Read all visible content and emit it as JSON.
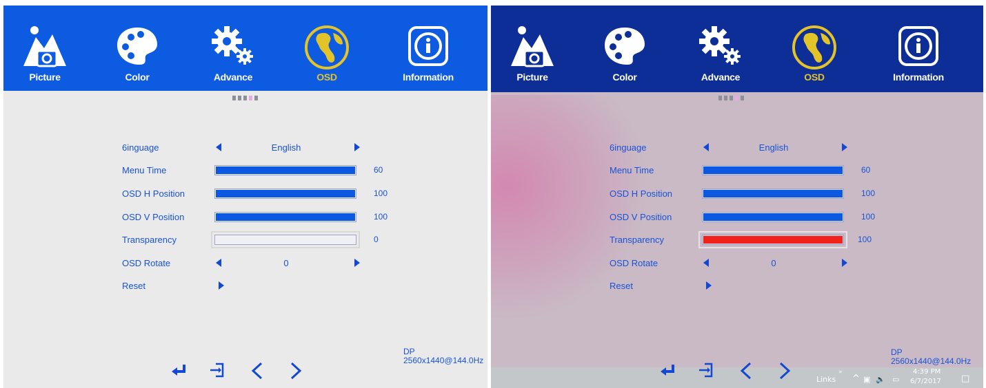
{
  "tabs": [
    {
      "label": "Picture",
      "icon": "picture-icon"
    },
    {
      "label": "Color",
      "icon": "palette-icon"
    },
    {
      "label": "Advance",
      "icon": "gear-icon"
    },
    {
      "label": "OSD",
      "icon": "globe-icon",
      "active": true
    },
    {
      "label": "Information",
      "icon": "info-icon"
    }
  ],
  "colors": {
    "header_left": "#0c5be0",
    "header_right": "#0d2d97",
    "text_blue": "#1852d8",
    "accent_yellow": "#e3c32a",
    "slider_fill": "#0c58e0",
    "transparency_fill_right": "#f0221a"
  },
  "left": {
    "rows": {
      "language": {
        "label": "6inguage",
        "value": "English"
      },
      "menu_time": {
        "label": "Menu Time",
        "value": "60",
        "level": 1.0
      },
      "osd_h": {
        "label": "OSD H Position",
        "value": "100",
        "level": 1.0
      },
      "osd_v": {
        "label": "OSD V Position",
        "value": "100",
        "level": 1.0
      },
      "transparency": {
        "label": "Transparency",
        "value": "0",
        "level": 0.0
      },
      "rotate": {
        "label": "OSD Rotate",
        "value": "0"
      },
      "reset": {
        "label": "Reset"
      }
    },
    "signal": {
      "port": "DP",
      "mode": "2560x1440@144.0Hz"
    }
  },
  "right": {
    "rows": {
      "language": {
        "label": "6inguage",
        "value": "English"
      },
      "menu_time": {
        "label": "Menu Time",
        "value": "60",
        "level": 1.0
      },
      "osd_h": {
        "label": "OSD H Position",
        "value": "100",
        "level": 1.0
      },
      "osd_v": {
        "label": "OSD V Position",
        "value": "100",
        "level": 1.0
      },
      "transparency": {
        "label": "Transparency",
        "value": "100",
        "level": 1.0
      },
      "rotate": {
        "label": "OSD Rotate",
        "value": "0"
      },
      "reset": {
        "label": "Reset"
      }
    },
    "signal": {
      "port": "DP",
      "mode": "2560x1440@144.0Hz"
    },
    "taskbar": {
      "links": "Links",
      "chevron": "»",
      "time": "4:39 PM",
      "date": "6/7/2017"
    }
  },
  "nav_icons": [
    "enter-icon",
    "exit-icon",
    "chevron-left-icon",
    "chevron-right-icon"
  ]
}
